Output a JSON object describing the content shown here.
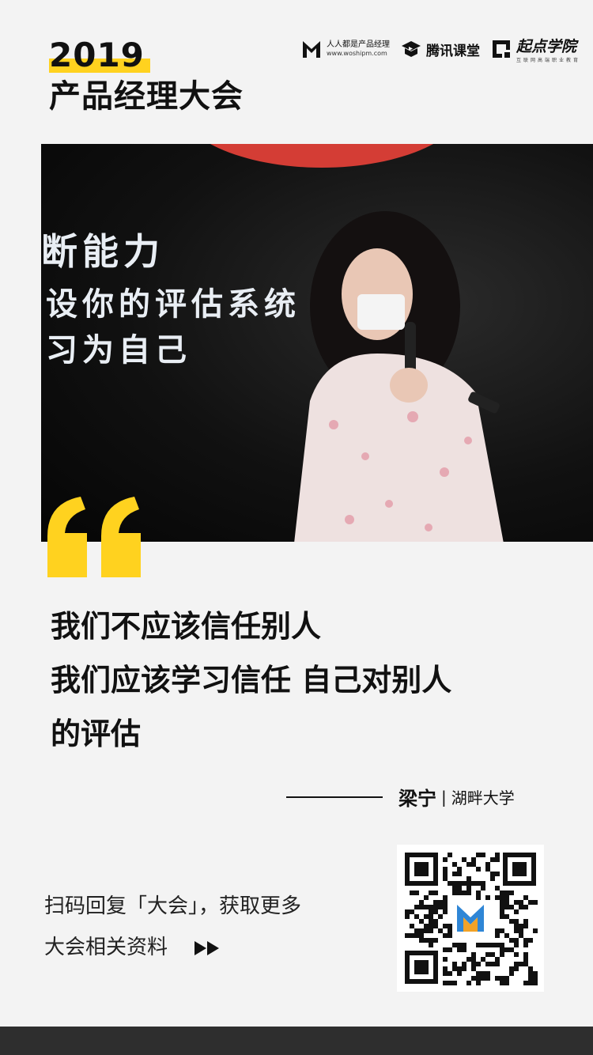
{
  "header": {
    "year": "2019",
    "event_title": "产品经理大会"
  },
  "logos": [
    {
      "name": "人人都是产品经理",
      "sub": "www.woshipm.com",
      "icon": "woshipm-m-logo-icon"
    },
    {
      "name": "腾讯课堂",
      "icon": "tencent-classroom-logo-icon"
    },
    {
      "name": "起点学院",
      "sub": "互联网高端职业教育",
      "icon": "qidian-logo-icon"
    }
  ],
  "photo": {
    "screen_lines": [
      "断能力",
      "设你的评估系统",
      "习为自己"
    ]
  },
  "quote": {
    "lines": [
      "我们不应该信任别人",
      "我们应该学习信任 自己对别人",
      "的评估"
    ]
  },
  "attribution": {
    "name": "梁宁",
    "separator": "|",
    "org": "湖畔大学"
  },
  "cta": {
    "line1": "扫码回复「大会」，获取更多",
    "line2": "大会相关资料"
  },
  "colors": {
    "accent": "#ffd21f",
    "background": "#f3f3f3",
    "text": "#111111",
    "footer": "#2e2e2e"
  }
}
